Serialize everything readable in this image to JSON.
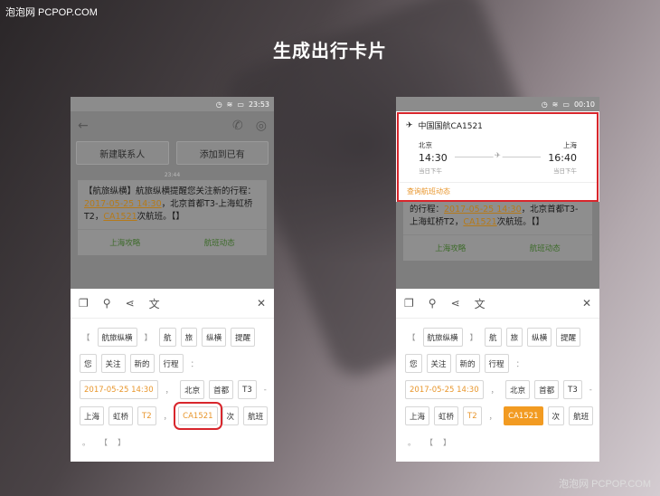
{
  "watermark": {
    "top_left": "泡泡网 PCPOP.COM",
    "bottom_right": "泡泡网 PCPOP.COM"
  },
  "headline": "生成出行卡片",
  "left": {
    "time": "23:53",
    "buttons": [
      "新建联系人",
      "添加到已有"
    ],
    "timestamp": "23:44",
    "message": {
      "p1": "【航旅纵横】航旅纵横提醒您关注新的行程：",
      "date": "2017-05-25 14:30",
      "p2": "，北京首都T3-上海虹桥T2，",
      "flight": "CA1521",
      "p3": "次航班。【】"
    },
    "actions": [
      "上海攻略",
      "航班动态"
    ]
  },
  "right": {
    "time": "00:10",
    "card": {
      "title": "中国国航CA1521",
      "from_city": "北京",
      "from_time": "14:30",
      "from_sub": "当日下午",
      "to_city": "上海",
      "to_time": "16:40",
      "to_sub": "当日下午",
      "link": "查询航班动态"
    },
    "bubble_tail": "的行程：",
    "bubble_date": "2017-05-25 14:30",
    "bubble_tail2": "，北京首都T3-上海虹桥T2，",
    "bubble_flight": "CA1521",
    "bubble_tail3": "次航班。【】",
    "actions": [
      "上海攻略",
      "航班动态"
    ]
  },
  "chips": {
    "row1": [
      "【",
      "航旅纵横",
      "】",
      "航",
      "旅",
      "纵横",
      "提醒"
    ],
    "row2": [
      "您",
      "关注",
      "新的",
      "行程",
      "："
    ],
    "row3": [
      "2017-05-25 14:30",
      "，",
      "北京",
      "首都",
      "T3",
      "-"
    ],
    "row4": [
      "上海",
      "虹桥",
      "T2",
      "，",
      "CA1521",
      "次",
      "航班"
    ],
    "row5": [
      "。",
      "【",
      "】"
    ]
  },
  "colors": {
    "accent": "#f29b22",
    "highlight_red": "#d8262c"
  }
}
